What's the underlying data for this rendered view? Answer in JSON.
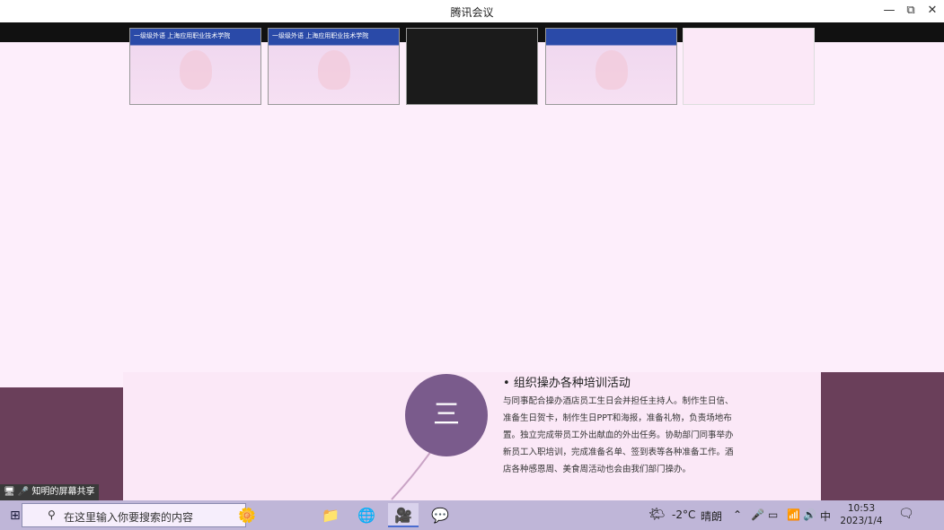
{
  "window": {
    "title": "腾讯会议",
    "controls": {
      "minimize": "—",
      "maximize": "⧉",
      "close": "✕"
    }
  },
  "video_strip": {
    "tiles": [
      {
        "caption": "一级级外语    上海应用职业技术学院"
      },
      {
        "caption": "一级级外语    上海应用职业技术学院"
      },
      {
        "caption": ""
      },
      {
        "caption": ""
      },
      {
        "caption": ""
      }
    ]
  },
  "slide": {
    "circle_label": "三",
    "bullet_title": "组织操办各种培训活动",
    "body": "与同事配合操办酒店员工生日会并担任主持人。制作生日信、准备生日贺卡，制作生日PPT和海报，准备礼物，负责场地布置。独立完成带员工外出献血的外出任务。协助部门同事举办新员工入职培训，完成准备名单、签到表等各种准备工作。酒店各种感恩周、美食周活动也会由我们部门操办。"
  },
  "screen_share_tag": "知明的屏幕共享",
  "taskbar": {
    "search_placeholder": "在这里输入你要搜索的内容",
    "weather_temp": "-2°C",
    "weather_text": "晴朗",
    "ime": "中",
    "time": "10:53",
    "date": "2023/1/4"
  },
  "colors": {
    "accent_circle": "#7a5b8c",
    "side_panel": "#6a3f5a",
    "taskbar": "#bfb6d8"
  }
}
